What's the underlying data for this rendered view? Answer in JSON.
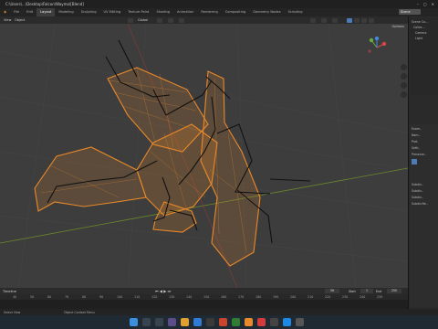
{
  "window": {
    "title": "C:\\Users\\...\\Desktop\\Falcon\\Waymo\\[Blend]"
  },
  "workspace_tabs": [
    "Layout",
    "Modeling",
    "Sculpting",
    "UV Editing",
    "Texture Paint",
    "Shading",
    "Animation",
    "Rendering",
    "Compositing",
    "Geometry Nodes",
    "Scripting"
  ],
  "scene": {
    "label": "Scene"
  },
  "viewport_header": {
    "mode": "Object",
    "view": "View",
    "select": "Select",
    "add": "Add",
    "object": "Object",
    "transform": "Global",
    "options": "Options"
  },
  "outliner": {
    "items": [
      "Scene Co...",
      "Collec...",
      "Camera",
      "Light"
    ]
  },
  "properties": {
    "rows": [
      "Exam..",
      "Nam..",
      "Prot.",
      "Setti..",
      "Preserve..",
      "Subdiv..",
      "Subdiv..",
      "Subdiv..",
      "Subdiv.Re.."
    ]
  },
  "timeline": {
    "label": "Timeline",
    "start_label": "Start",
    "start": "1",
    "end_label": "End",
    "end": "250",
    "current_frame": "56",
    "ticks": [
      "40",
      "50",
      "60",
      "70",
      "80",
      "90",
      "100",
      "110",
      "120",
      "130",
      "140",
      "150",
      "160",
      "170",
      "180",
      "190",
      "200",
      "210",
      "220",
      "230",
      "240",
      "250"
    ]
  },
  "status_bar": {
    "left": "Select View",
    "middle": "Object Context Menu"
  },
  "taskbar": {
    "clock": "",
    "colors": {
      "start": "#3b8fdc"
    }
  },
  "colors": {
    "wire": "#e8892a",
    "bone": "#111111",
    "viewport": "#3d3d3d",
    "active_tab": "#3d3d3d"
  }
}
